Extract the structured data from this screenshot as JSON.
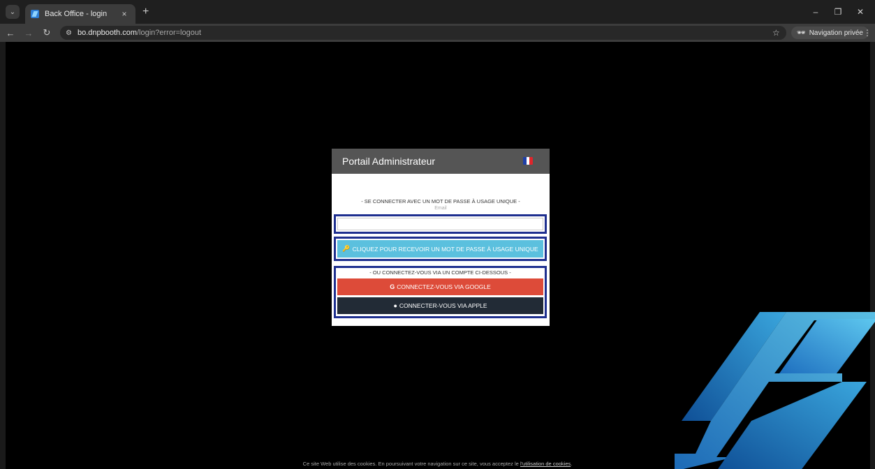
{
  "browser": {
    "tab_title": "Back Office - login",
    "tab_close": "×",
    "new_tab": "+",
    "url_host": "bo.dnpbooth.com",
    "url_path": "/login?error=logout",
    "incognito_label": "Navigation privée",
    "window_controls": {
      "minimize": "–",
      "restore": "❐",
      "close": "✕"
    }
  },
  "panel": {
    "title": "Portail Administrateur",
    "flag_colors": [
      "#1f3fa8",
      "#ffffff",
      "#e0252b"
    ],
    "otp_heading": "- SE CONNECTER AVEC UN MOT DE PASSE À USAGE UNIQUE -",
    "email_label": "Email",
    "email_value": "",
    "otp_button": "CLIQUEZ POUR RECEVOIR UN MOT DE PASSE À USAGE UNIQUE",
    "alt_heading": "- OU CONNECTEZ-VOUS VIA UN COMPTE CI-DESSOUS -",
    "google_button": "CONNECTEZ-VOUS VIA GOOGLE",
    "apple_button": "CONNECTER-VOUS VIA APPLE"
  },
  "cookie": {
    "text": "Ce site Web utilise des cookies. En poursuivant votre navigation sur ce site, vous acceptez le ",
    "link": "l'utilisation de cookies",
    "suffix": "."
  },
  "colors": {
    "otp_button": "#5bc0de",
    "google_button": "#dd4b39",
    "apple_button": "#222b36",
    "frame": "#1e2f8f",
    "header": "#555555"
  }
}
